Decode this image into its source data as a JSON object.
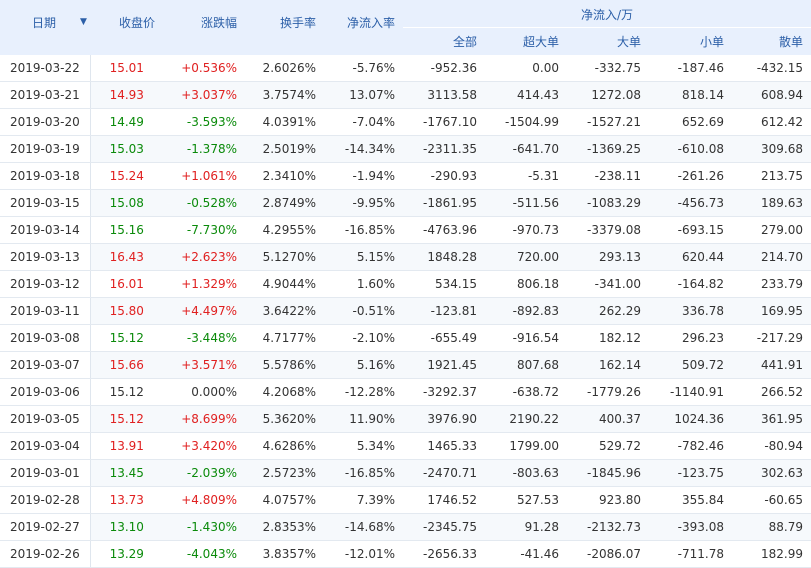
{
  "headers": {
    "date": "日期",
    "close": "收盘价",
    "change": "涨跌幅",
    "turnover": "换手率",
    "netflow_rate": "净流入率",
    "netflow_group": "净流入/万",
    "all": "全部",
    "super_large": "超大单",
    "large": "大单",
    "small": "小单",
    "retail": "散单"
  },
  "colors": {
    "up": "#e02020",
    "down": "#0a8a0a",
    "header_bg": "#e8f0fd",
    "header_text": "#2c5fa8"
  },
  "rows": [
    {
      "date": "2019-03-22",
      "close": "15.01",
      "change": "+0.536%",
      "dir": "up",
      "turnover": "2.6026%",
      "rate": "-5.76%",
      "all": "-952.36",
      "super": "0.00",
      "large": "-332.75",
      "small": "-187.46",
      "retail": "-432.15"
    },
    {
      "date": "2019-03-21",
      "close": "14.93",
      "change": "+3.037%",
      "dir": "up",
      "turnover": "3.7574%",
      "rate": "13.07%",
      "all": "3113.58",
      "super": "414.43",
      "large": "1272.08",
      "small": "818.14",
      "retail": "608.94"
    },
    {
      "date": "2019-03-20",
      "close": "14.49",
      "change": "-3.593%",
      "dir": "down",
      "turnover": "4.0391%",
      "rate": "-7.04%",
      "all": "-1767.10",
      "super": "-1504.99",
      "large": "-1527.21",
      "small": "652.69",
      "retail": "612.42"
    },
    {
      "date": "2019-03-19",
      "close": "15.03",
      "change": "-1.378%",
      "dir": "down",
      "turnover": "2.5019%",
      "rate": "-14.34%",
      "all": "-2311.35",
      "super": "-641.70",
      "large": "-1369.25",
      "small": "-610.08",
      "retail": "309.68"
    },
    {
      "date": "2019-03-18",
      "close": "15.24",
      "change": "+1.061%",
      "dir": "up",
      "turnover": "2.3410%",
      "rate": "-1.94%",
      "all": "-290.93",
      "super": "-5.31",
      "large": "-238.11",
      "small": "-261.26",
      "retail": "213.75"
    },
    {
      "date": "2019-03-15",
      "close": "15.08",
      "change": "-0.528%",
      "dir": "down",
      "turnover": "2.8749%",
      "rate": "-9.95%",
      "all": "-1861.95",
      "super": "-511.56",
      "large": "-1083.29",
      "small": "-456.73",
      "retail": "189.63"
    },
    {
      "date": "2019-03-14",
      "close": "15.16",
      "change": "-7.730%",
      "dir": "down",
      "turnover": "4.2955%",
      "rate": "-16.85%",
      "all": "-4763.96",
      "super": "-970.73",
      "large": "-3379.08",
      "small": "-693.15",
      "retail": "279.00"
    },
    {
      "date": "2019-03-13",
      "close": "16.43",
      "change": "+2.623%",
      "dir": "up",
      "turnover": "5.1270%",
      "rate": "5.15%",
      "all": "1848.28",
      "super": "720.00",
      "large": "293.13",
      "small": "620.44",
      "retail": "214.70"
    },
    {
      "date": "2019-03-12",
      "close": "16.01",
      "change": "+1.329%",
      "dir": "up",
      "turnover": "4.9044%",
      "rate": "1.60%",
      "all": "534.15",
      "super": "806.18",
      "large": "-341.00",
      "small": "-164.82",
      "retail": "233.79"
    },
    {
      "date": "2019-03-11",
      "close": "15.80",
      "change": "+4.497%",
      "dir": "up",
      "turnover": "3.6422%",
      "rate": "-0.51%",
      "all": "-123.81",
      "super": "-892.83",
      "large": "262.29",
      "small": "336.78",
      "retail": "169.95"
    },
    {
      "date": "2019-03-08",
      "close": "15.12",
      "change": "-3.448%",
      "dir": "down",
      "turnover": "4.7177%",
      "rate": "-2.10%",
      "all": "-655.49",
      "super": "-916.54",
      "large": "182.12",
      "small": "296.23",
      "retail": "-217.29"
    },
    {
      "date": "2019-03-07",
      "close": "15.66",
      "change": "+3.571%",
      "dir": "up",
      "turnover": "5.5786%",
      "rate": "5.16%",
      "all": "1921.45",
      "super": "807.68",
      "large": "162.14",
      "small": "509.72",
      "retail": "441.91"
    },
    {
      "date": "2019-03-06",
      "close": "15.12",
      "change": "0.000%",
      "dir": "flat",
      "turnover": "4.2068%",
      "rate": "-12.28%",
      "all": "-3292.37",
      "super": "-638.72",
      "large": "-1779.26",
      "small": "-1140.91",
      "retail": "266.52"
    },
    {
      "date": "2019-03-05",
      "close": "15.12",
      "change": "+8.699%",
      "dir": "up",
      "turnover": "5.3620%",
      "rate": "11.90%",
      "all": "3976.90",
      "super": "2190.22",
      "large": "400.37",
      "small": "1024.36",
      "retail": "361.95"
    },
    {
      "date": "2019-03-04",
      "close": "13.91",
      "change": "+3.420%",
      "dir": "up",
      "turnover": "4.6286%",
      "rate": "5.34%",
      "all": "1465.33",
      "super": "1799.00",
      "large": "529.72",
      "small": "-782.46",
      "retail": "-80.94"
    },
    {
      "date": "2019-03-01",
      "close": "13.45",
      "change": "-2.039%",
      "dir": "down",
      "turnover": "2.5723%",
      "rate": "-16.85%",
      "all": "-2470.71",
      "super": "-803.63",
      "large": "-1845.96",
      "small": "-123.75",
      "retail": "302.63"
    },
    {
      "date": "2019-02-28",
      "close": "13.73",
      "change": "+4.809%",
      "dir": "up",
      "turnover": "4.0757%",
      "rate": "7.39%",
      "all": "1746.52",
      "super": "527.53",
      "large": "923.80",
      "small": "355.84",
      "retail": "-60.65"
    },
    {
      "date": "2019-02-27",
      "close": "13.10",
      "change": "-1.430%",
      "dir": "down",
      "turnover": "2.8353%",
      "rate": "-14.68%",
      "all": "-2345.75",
      "super": "91.28",
      "large": "-2132.73",
      "small": "-393.08",
      "retail": "88.79"
    },
    {
      "date": "2019-02-26",
      "close": "13.29",
      "change": "-4.043%",
      "dir": "down",
      "turnover": "3.8357%",
      "rate": "-12.01%",
      "all": "-2656.33",
      "super": "-41.46",
      "large": "-2086.07",
      "small": "-711.78",
      "retail": "182.99"
    }
  ]
}
